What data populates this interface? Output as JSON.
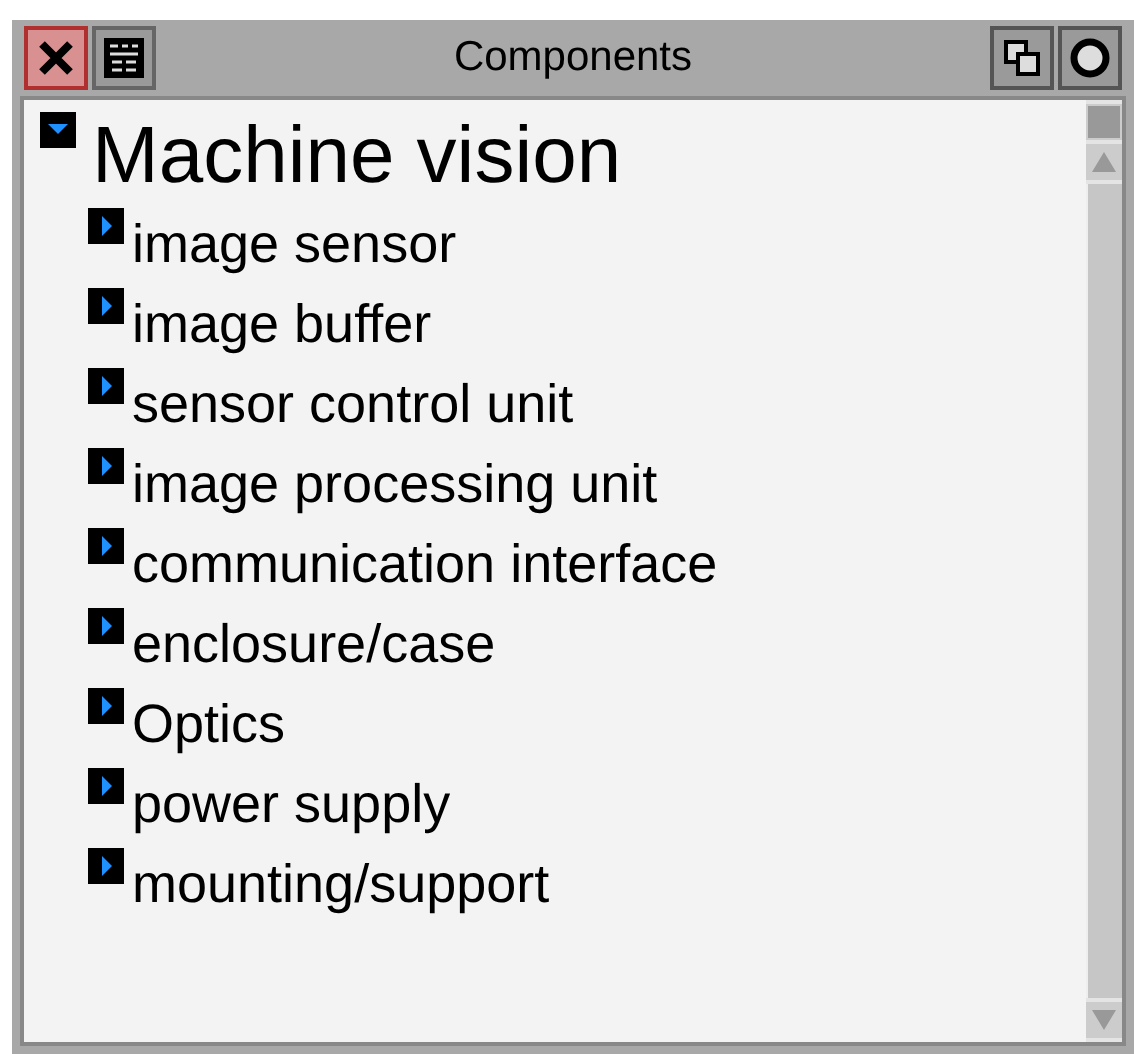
{
  "window": {
    "title": "Components"
  },
  "tree": [
    {
      "label": "Machine vision",
      "expanded": true,
      "children": [
        {
          "label": "image sensor",
          "expanded": false
        },
        {
          "label": "image buffer",
          "expanded": false
        },
        {
          "label": "sensor control unit",
          "expanded": false
        },
        {
          "label": "image processing unit",
          "expanded": false
        },
        {
          "label": "communication interface",
          "expanded": false
        },
        {
          "label": "enclosure/case",
          "expanded": false
        },
        {
          "label": "Optics",
          "expanded": false
        },
        {
          "label": "power supply",
          "expanded": false
        },
        {
          "label": "mounting/support",
          "expanded": false
        }
      ]
    }
  ]
}
